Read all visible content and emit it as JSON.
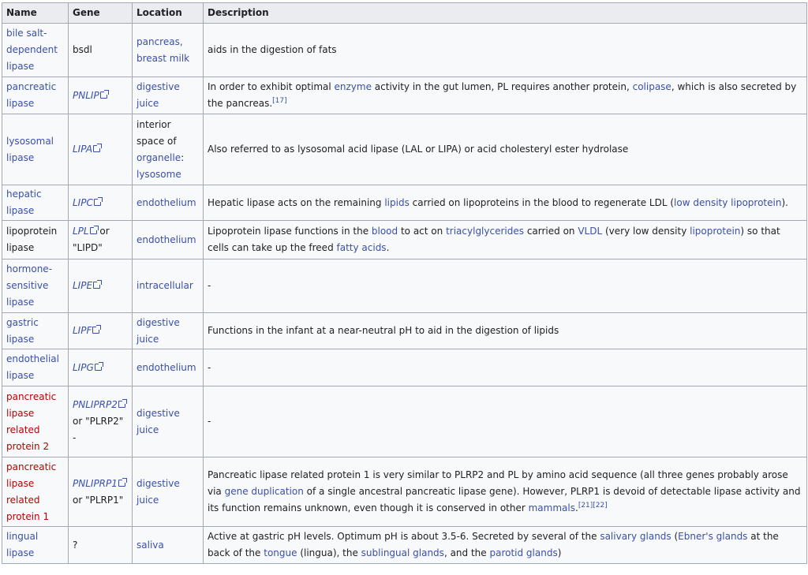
{
  "headers": [
    "Name",
    "Gene",
    "Location",
    "Description"
  ],
  "colors": {
    "link": "#3a4fa8",
    "redlink": "#ba0000",
    "header_bg": "#eaecf0",
    "cell_bg": "#f8f9fa",
    "border": "#a2a9b1"
  },
  "rows": [
    {
      "name": [
        [
          "bile salt-dependent lipase",
          "l"
        ]
      ],
      "gene": [
        [
          "bsdl",
          "t"
        ]
      ],
      "location": [
        [
          "pancreas, breast milk",
          "l"
        ]
      ],
      "description": [
        [
          "aids in the digestion of fats",
          "t"
        ]
      ]
    },
    {
      "name": [
        [
          "pancreatic lipase",
          "l"
        ]
      ],
      "gene": [
        [
          "PNLIP",
          "i"
        ]
      ],
      "location": [
        [
          "digestive juice",
          "l"
        ]
      ],
      "description": [
        [
          "In order to exhibit optimal ",
          "t"
        ],
        [
          "enzyme",
          "l"
        ],
        [
          " activity in the gut lumen, PL requires another protein, ",
          "t"
        ],
        [
          "colipase",
          "l"
        ],
        [
          ", which is also secreted by the pancreas.",
          "t"
        ],
        [
          "[17]",
          "s"
        ]
      ]
    },
    {
      "name": [
        [
          "lysosomal lipase",
          "l"
        ]
      ],
      "gene": [
        [
          "LIPA",
          "i"
        ]
      ],
      "location": [
        [
          "interior space of ",
          "t"
        ],
        [
          "organelle",
          "l"
        ],
        [
          ": ",
          "t"
        ],
        [
          "lysosome",
          "l"
        ]
      ],
      "description": [
        [
          "Also referred to as lysosomal acid lipase (LAL or LIPA) or acid cholesteryl ester hydrolase",
          "t"
        ]
      ]
    },
    {
      "name": [
        [
          "hepatic lipase",
          "l"
        ]
      ],
      "gene": [
        [
          "LIPC",
          "i"
        ]
      ],
      "location": [
        [
          "endothelium",
          "l"
        ]
      ],
      "description": [
        [
          "Hepatic lipase acts on the remaining ",
          "t"
        ],
        [
          "lipids",
          "l"
        ],
        [
          " carried on lipoproteins in the blood to regenerate LDL (",
          "t"
        ],
        [
          "low density lipoprotein",
          "l"
        ],
        [
          ").",
          "t"
        ]
      ]
    },
    {
      "name": [
        [
          "lipoprotein lipase",
          "t"
        ]
      ],
      "gene": [
        [
          "LPL",
          "i"
        ],
        [
          " or \"LIPD\"",
          "t"
        ]
      ],
      "location": [
        [
          "endothelium",
          "l"
        ]
      ],
      "description": [
        [
          "Lipoprotein lipase functions in the ",
          "t"
        ],
        [
          "blood",
          "l"
        ],
        [
          " to act on ",
          "t"
        ],
        [
          "triacylglycerides",
          "l"
        ],
        [
          " carried on ",
          "t"
        ],
        [
          "VLDL",
          "l"
        ],
        [
          " (very low density ",
          "t"
        ],
        [
          "lipoprotein",
          "l"
        ],
        [
          ") so that cells can take up the freed ",
          "t"
        ],
        [
          "fatty acids",
          "l"
        ],
        [
          ".",
          "t"
        ]
      ]
    },
    {
      "name": [
        [
          "hormone-sensitive lipase",
          "l"
        ]
      ],
      "gene": [
        [
          "LIPE",
          "i"
        ]
      ],
      "location": [
        [
          "intracellular",
          "l"
        ]
      ],
      "description": [
        [
          "-",
          "t"
        ]
      ]
    },
    {
      "name": [
        [
          "gastric lipase",
          "l"
        ]
      ],
      "gene": [
        [
          "LIPF",
          "i"
        ]
      ],
      "location": [
        [
          "digestive juice",
          "l"
        ]
      ],
      "description": [
        [
          "Functions in the infant at a near-neutral pH to aid in the digestion of lipids",
          "t"
        ]
      ]
    },
    {
      "name": [
        [
          "endothelial lipase",
          "l"
        ]
      ],
      "gene": [
        [
          "LIPG",
          "i"
        ]
      ],
      "location": [
        [
          "endothelium",
          "l"
        ]
      ],
      "description": [
        [
          "-",
          "t"
        ]
      ]
    },
    {
      "name": [
        [
          "pancreatic lipase related protein 2",
          "r"
        ]
      ],
      "gene": [
        [
          "PNLIPRP2",
          "i"
        ],
        [
          " or \"PLRP2\" -",
          "t"
        ]
      ],
      "location": [
        [
          "digestive juice",
          "l"
        ]
      ],
      "description": [
        [
          "-",
          "t"
        ]
      ]
    },
    {
      "name": [
        [
          "pancreatic lipase related protein 1",
          "r"
        ]
      ],
      "gene": [
        [
          "PNLIPRP1",
          "i"
        ],
        [
          " or \"PLRP1\"",
          "t"
        ]
      ],
      "location": [
        [
          "digestive juice",
          "l"
        ]
      ],
      "description": [
        [
          "Pancreatic lipase related protein 1 is very similar to PLRP2 and PL by amino acid sequence (all three genes probably arose via ",
          "t"
        ],
        [
          "gene duplication",
          "l"
        ],
        [
          " of a single ancestral pancreatic lipase gene). However, PLRP1 is devoid of detectable lipase activity and its function remains unknown, even though it is conserved in other ",
          "t"
        ],
        [
          "mammals",
          "l"
        ],
        [
          ".",
          "t"
        ],
        [
          "[21]",
          "s"
        ],
        [
          "[22]",
          "s"
        ]
      ]
    },
    {
      "name": [
        [
          "lingual lipase",
          "l"
        ]
      ],
      "gene": [
        [
          "?",
          "t"
        ]
      ],
      "location": [
        [
          "saliva",
          "l"
        ]
      ],
      "description": [
        [
          "Active at gastric pH levels. Optimum pH is about 3.5-6. Secreted by several of the ",
          "t"
        ],
        [
          "salivary glands",
          "l"
        ],
        [
          " (",
          "t"
        ],
        [
          "Ebner's glands",
          "l"
        ],
        [
          " at the back of the ",
          "t"
        ],
        [
          "tongue",
          "l"
        ],
        [
          " (lingua), the ",
          "t"
        ],
        [
          "sublingual glands",
          "l"
        ],
        [
          ", and the ",
          "t"
        ],
        [
          "parotid glands",
          "l"
        ],
        [
          ")",
          "t"
        ]
      ]
    }
  ]
}
